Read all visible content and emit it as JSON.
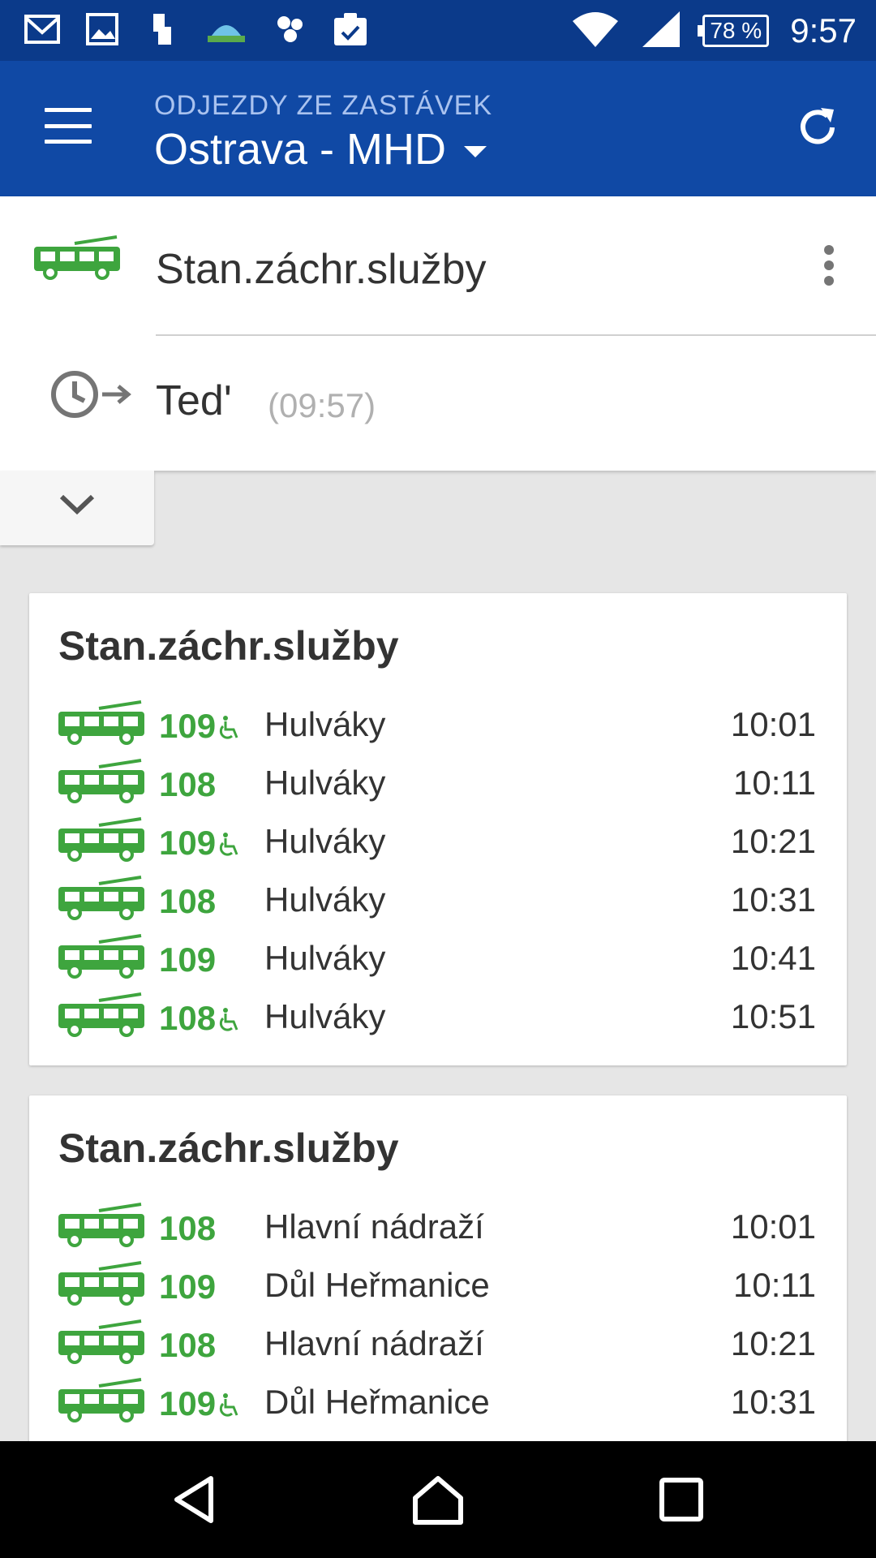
{
  "status_bar": {
    "battery": "78 %",
    "time": "9:57",
    "icons": [
      "gmail-icon",
      "gallery-icon",
      "sim-icon",
      "weather-icon",
      "app-icon",
      "clipboard-check-icon",
      "wifi-icon",
      "signal-icon"
    ]
  },
  "app_bar": {
    "subtitle": "ODJEZDY ZE ZASTÁVEK",
    "title": "Ostrava - MHD"
  },
  "selector": {
    "stop_name": "Stan.záchr.služby",
    "time_label": "Ted'",
    "time_value": "(09:57)"
  },
  "cards": [
    {
      "title": "Stan.záchr.služby",
      "departures": [
        {
          "line": "109",
          "accessible": true,
          "destination": "Hulváky",
          "time": "10:01"
        },
        {
          "line": "108",
          "accessible": false,
          "destination": "Hulváky",
          "time": "10:11"
        },
        {
          "line": "109",
          "accessible": true,
          "destination": "Hulváky",
          "time": "10:21"
        },
        {
          "line": "108",
          "accessible": false,
          "destination": "Hulváky",
          "time": "10:31"
        },
        {
          "line": "109",
          "accessible": false,
          "destination": "Hulváky",
          "time": "10:41"
        },
        {
          "line": "108",
          "accessible": true,
          "destination": "Hulváky",
          "time": "10:51"
        }
      ]
    },
    {
      "title": "Stan.záchr.služby",
      "departures": [
        {
          "line": "108",
          "accessible": false,
          "destination": "Hlavní nádraží",
          "time": "10:01"
        },
        {
          "line": "109",
          "accessible": false,
          "destination": "Důl Heřmanice",
          "time": "10:11"
        },
        {
          "line": "108",
          "accessible": false,
          "destination": "Hlavní nádraží",
          "time": "10:21"
        },
        {
          "line": "109",
          "accessible": true,
          "destination": "Důl Heřmanice",
          "time": "10:31"
        }
      ]
    }
  ],
  "colors": {
    "status_bar": "#0b3a8a",
    "app_bar": "#1049a5",
    "accent_green": "#3ea53e",
    "background": "#e6e6e6"
  }
}
